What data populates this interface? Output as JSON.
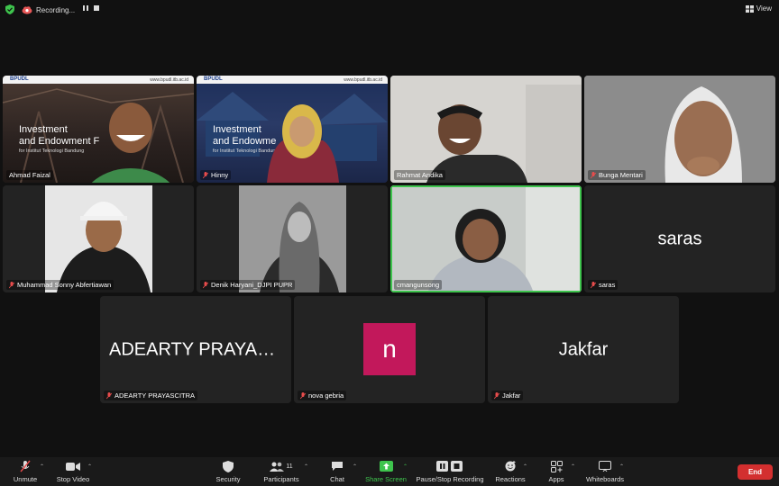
{
  "topbar": {
    "recording_label": "Recording...",
    "view_label": "View"
  },
  "tiles": {
    "t1": {
      "name": "Ahmad Faizal",
      "slide_logo": "BPUDL",
      "slide_url": "www.bpudl.itb.ac.id",
      "slide_title_1": "Investment",
      "slide_title_2": "and Endowment F",
      "slide_sub": "for Institut Teknologi Bandung"
    },
    "t2": {
      "name": "Hinny",
      "slide_logo": "BPUDL",
      "slide_url": "www.bpudl.itb.ac.id",
      "slide_title_1": "Investment",
      "slide_title_2": "and Endowme",
      "slide_sub": "for Institut Teknologi Bandung"
    },
    "t3": {
      "name": "Rahmat Andika"
    },
    "t4": {
      "name": "Bunga Mentari"
    },
    "t5": {
      "name": "Muhammad Sonny Abfertiawan"
    },
    "t6": {
      "name": "Denik Haryani_DJPI PUPR"
    },
    "t7": {
      "name": "cmangunsong"
    },
    "t8": {
      "name": "saras",
      "big": "saras"
    },
    "t9": {
      "name": "ADEARTY PRAYASCITRA",
      "big": "ADEARTY PRAYAS..."
    },
    "t10": {
      "name": "nova gebria",
      "initial": "n"
    },
    "t11": {
      "name": "Jakfar",
      "big": "Jakfar"
    }
  },
  "toolbar": {
    "unmute": "Unmute",
    "stop_video": "Stop Video",
    "security": "Security",
    "participants": "Participants",
    "participants_count": "11",
    "chat": "Chat",
    "share_screen": "Share Screen",
    "pause_stop_recording": "Pause/Stop Recording",
    "reactions": "Reactions",
    "apps": "Apps",
    "whiteboards": "Whiteboards",
    "end": "End"
  },
  "colors": {
    "active_speaker": "#3ec44d",
    "end_button": "#d32f2f",
    "avatar_nova": "#c2185b"
  }
}
